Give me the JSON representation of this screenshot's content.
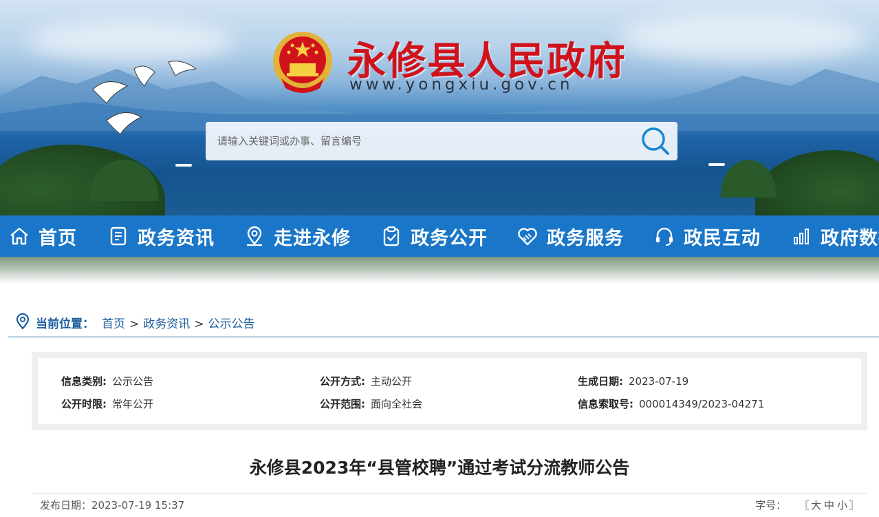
{
  "header": {
    "site_title": "永修县人民政府",
    "site_url": "www.yongxiu.gov.cn",
    "emblem_icon": "national-emblem-icon",
    "search": {
      "placeholder": "请输入关键词或办事、留言编号",
      "icon": "search-icon"
    }
  },
  "nav": {
    "items": [
      {
        "label": "首页",
        "icon": "home-icon"
      },
      {
        "label": "政务资讯",
        "icon": "document-icon"
      },
      {
        "label": "走进永修",
        "icon": "location-pin-icon"
      },
      {
        "label": "政务公开",
        "icon": "clipboard-check-icon"
      },
      {
        "label": "政务服务",
        "icon": "handshake-heart-icon"
      },
      {
        "label": "政民互动",
        "icon": "headset-icon"
      },
      {
        "label": "政府数据",
        "icon": "bar-chart-icon"
      }
    ]
  },
  "breadcrumb": {
    "label": "当前位置：",
    "items": [
      "首页",
      "政务资讯",
      "公示公告"
    ],
    "separator": ">"
  },
  "meta": {
    "category_label": "信息类别:",
    "category_value": "公示公告",
    "method_label": "公开方式:",
    "method_value": "主动公开",
    "generated_label": "生成日期:",
    "generated_value": "2023-07-19",
    "period_label": "公开时限:",
    "period_value": "常年公开",
    "scope_label": "公开范围:",
    "scope_value": "面向全社会",
    "index_label": "信息索取号:",
    "index_value": "000014349/2023-04271"
  },
  "article": {
    "title": "永修县2023年“县管校聘”通过考试分流教师公告",
    "publish_label": "发布日期：",
    "publish_value": "2023-07-19 15:37",
    "font_label": "字号：",
    "font_open": "〖",
    "font_large": "大",
    "font_medium": "中",
    "font_small": "小",
    "font_close": "〗"
  },
  "colors": {
    "nav_bg": "#1a76c8",
    "title_red": "#d0121b",
    "crumb_blue": "#1b5e9e"
  }
}
